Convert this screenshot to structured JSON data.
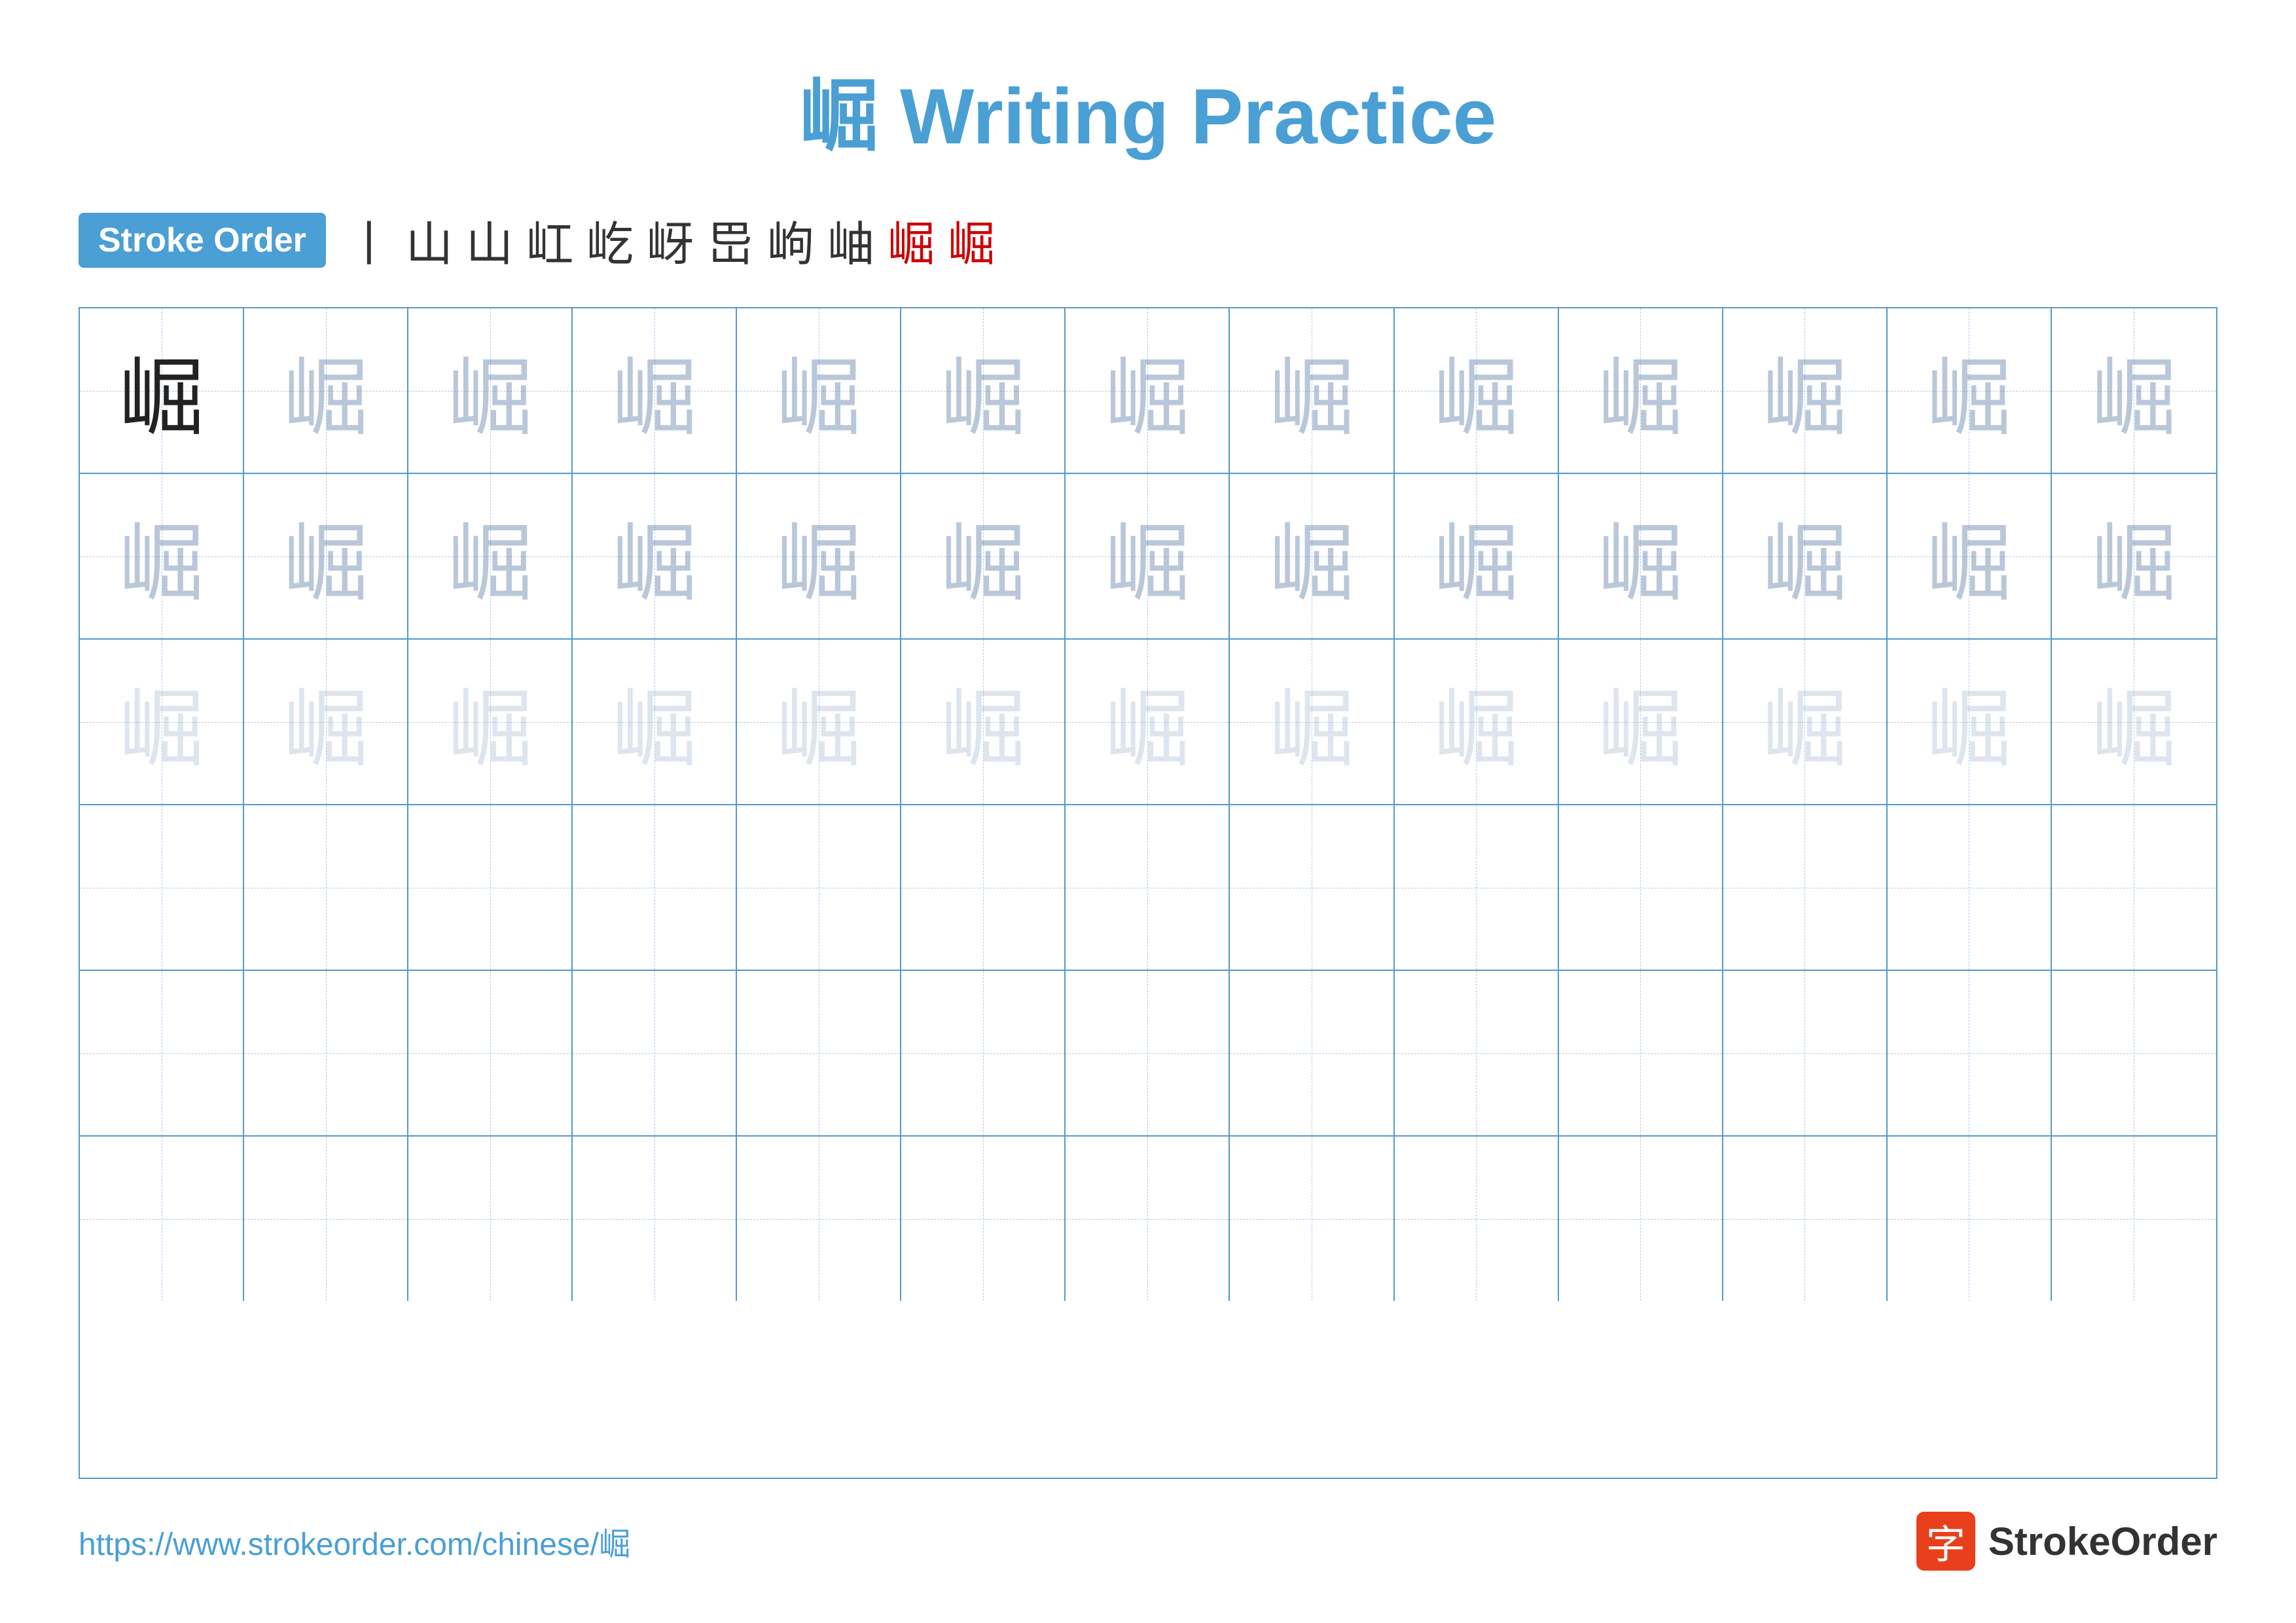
{
  "title": {
    "char": "崛",
    "label": "Writing Practice",
    "full": "崛 Writing Practice"
  },
  "stroke_order": {
    "badge": "Stroke Order",
    "steps": [
      "丨",
      "山",
      "山",
      "山⌐",
      "山⌐",
      "屵",
      "岨",
      "岨",
      "岨崛",
      "崛",
      "崛"
    ]
  },
  "character": "崛",
  "rows": [
    {
      "type": "full_then_dark",
      "count": 13
    },
    {
      "type": "dark",
      "count": 13
    },
    {
      "type": "light",
      "count": 13
    },
    {
      "type": "empty",
      "count": 13
    },
    {
      "type": "empty",
      "count": 13
    },
    {
      "type": "empty",
      "count": 13
    }
  ],
  "footer": {
    "url": "https://www.strokeorder.com/chinese/崛",
    "logo_char": "字",
    "logo_name": "StrokeOrder"
  }
}
